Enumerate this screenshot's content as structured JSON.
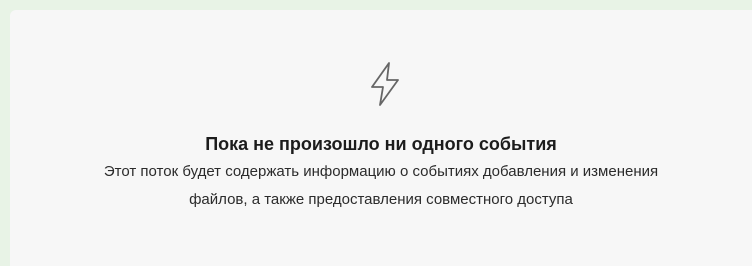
{
  "empty_state": {
    "icon": "lightning-bolt-icon",
    "title": "Пока не произошло ни одного события",
    "description_line1": "Этот поток будет содержать информацию о событиях добавления и изменения",
    "description_line2": "файлов, а также предоставления совместного доступа"
  },
  "colors": {
    "page_background": "#e8f3e6",
    "panel_background": "#f7f7f7",
    "icon_stroke": "#666666",
    "title_text": "#1c1c1c",
    "body_text": "#2b2b2b"
  }
}
